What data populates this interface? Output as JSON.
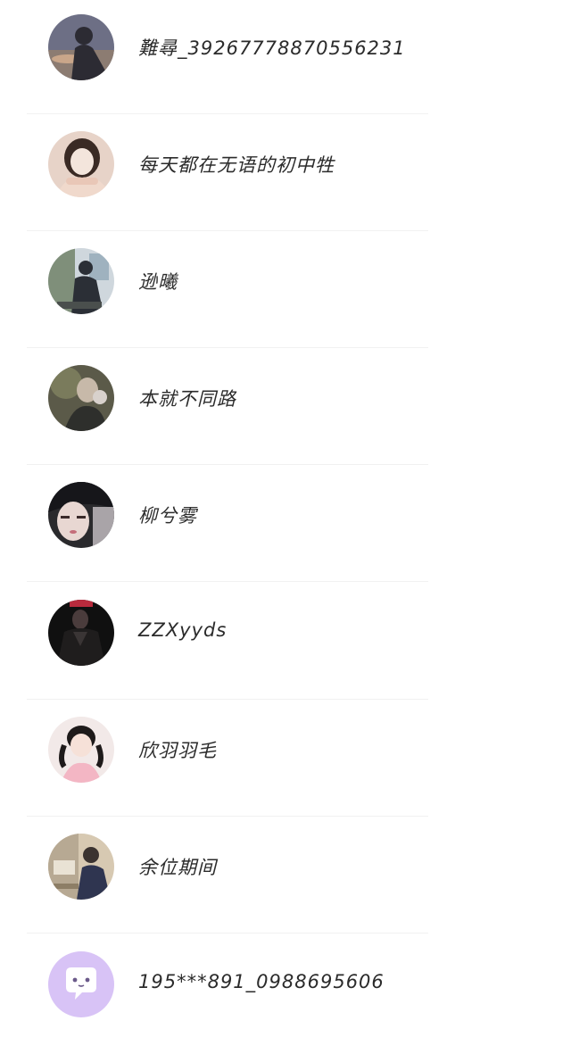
{
  "contacts": [
    {
      "name": "難尋_39267778870556231",
      "avatar": "photo-avatar-icon",
      "colors": [
        "#6d6f85",
        "#c9a68a",
        "#2c2b33"
      ]
    },
    {
      "name": "每天都在无语的初中牲",
      "avatar": "photo-avatar-icon",
      "colors": [
        "#e7d3c8",
        "#3a2a24",
        "#f3e5dc"
      ]
    },
    {
      "name": "逊曦",
      "avatar": "photo-avatar-icon",
      "colors": [
        "#7f8f7a",
        "#2b2f36",
        "#cfd7dd"
      ]
    },
    {
      "name": "本就不同路",
      "avatar": "photo-avatar-icon",
      "colors": [
        "#5b5a49",
        "#c7b9a9",
        "#2e2f2c"
      ]
    },
    {
      "name": "柳兮雾",
      "avatar": "photo-avatar-icon",
      "colors": [
        "#2a2a2d",
        "#e8d7d2",
        "#16161a"
      ]
    },
    {
      "name": "ZZXyyds",
      "avatar": "photo-avatar-icon",
      "colors": [
        "#101010",
        "#4a3c3c",
        "#b82b3d"
      ]
    },
    {
      "name": "欣羽羽毛",
      "avatar": "photo-avatar-icon",
      "colors": [
        "#f2e9e8",
        "#1e1a1a",
        "#f3b6c4"
      ]
    },
    {
      "name": "余位期间",
      "avatar": "photo-avatar-icon",
      "colors": [
        "#b7a993",
        "#2f3550",
        "#d7c9b2"
      ]
    },
    {
      "name": "195***891_0988695606",
      "avatar": "default-chat-avatar-icon",
      "colors": [
        "#d8c3f6",
        "#ffffff",
        "#6b5a8a"
      ]
    }
  ]
}
